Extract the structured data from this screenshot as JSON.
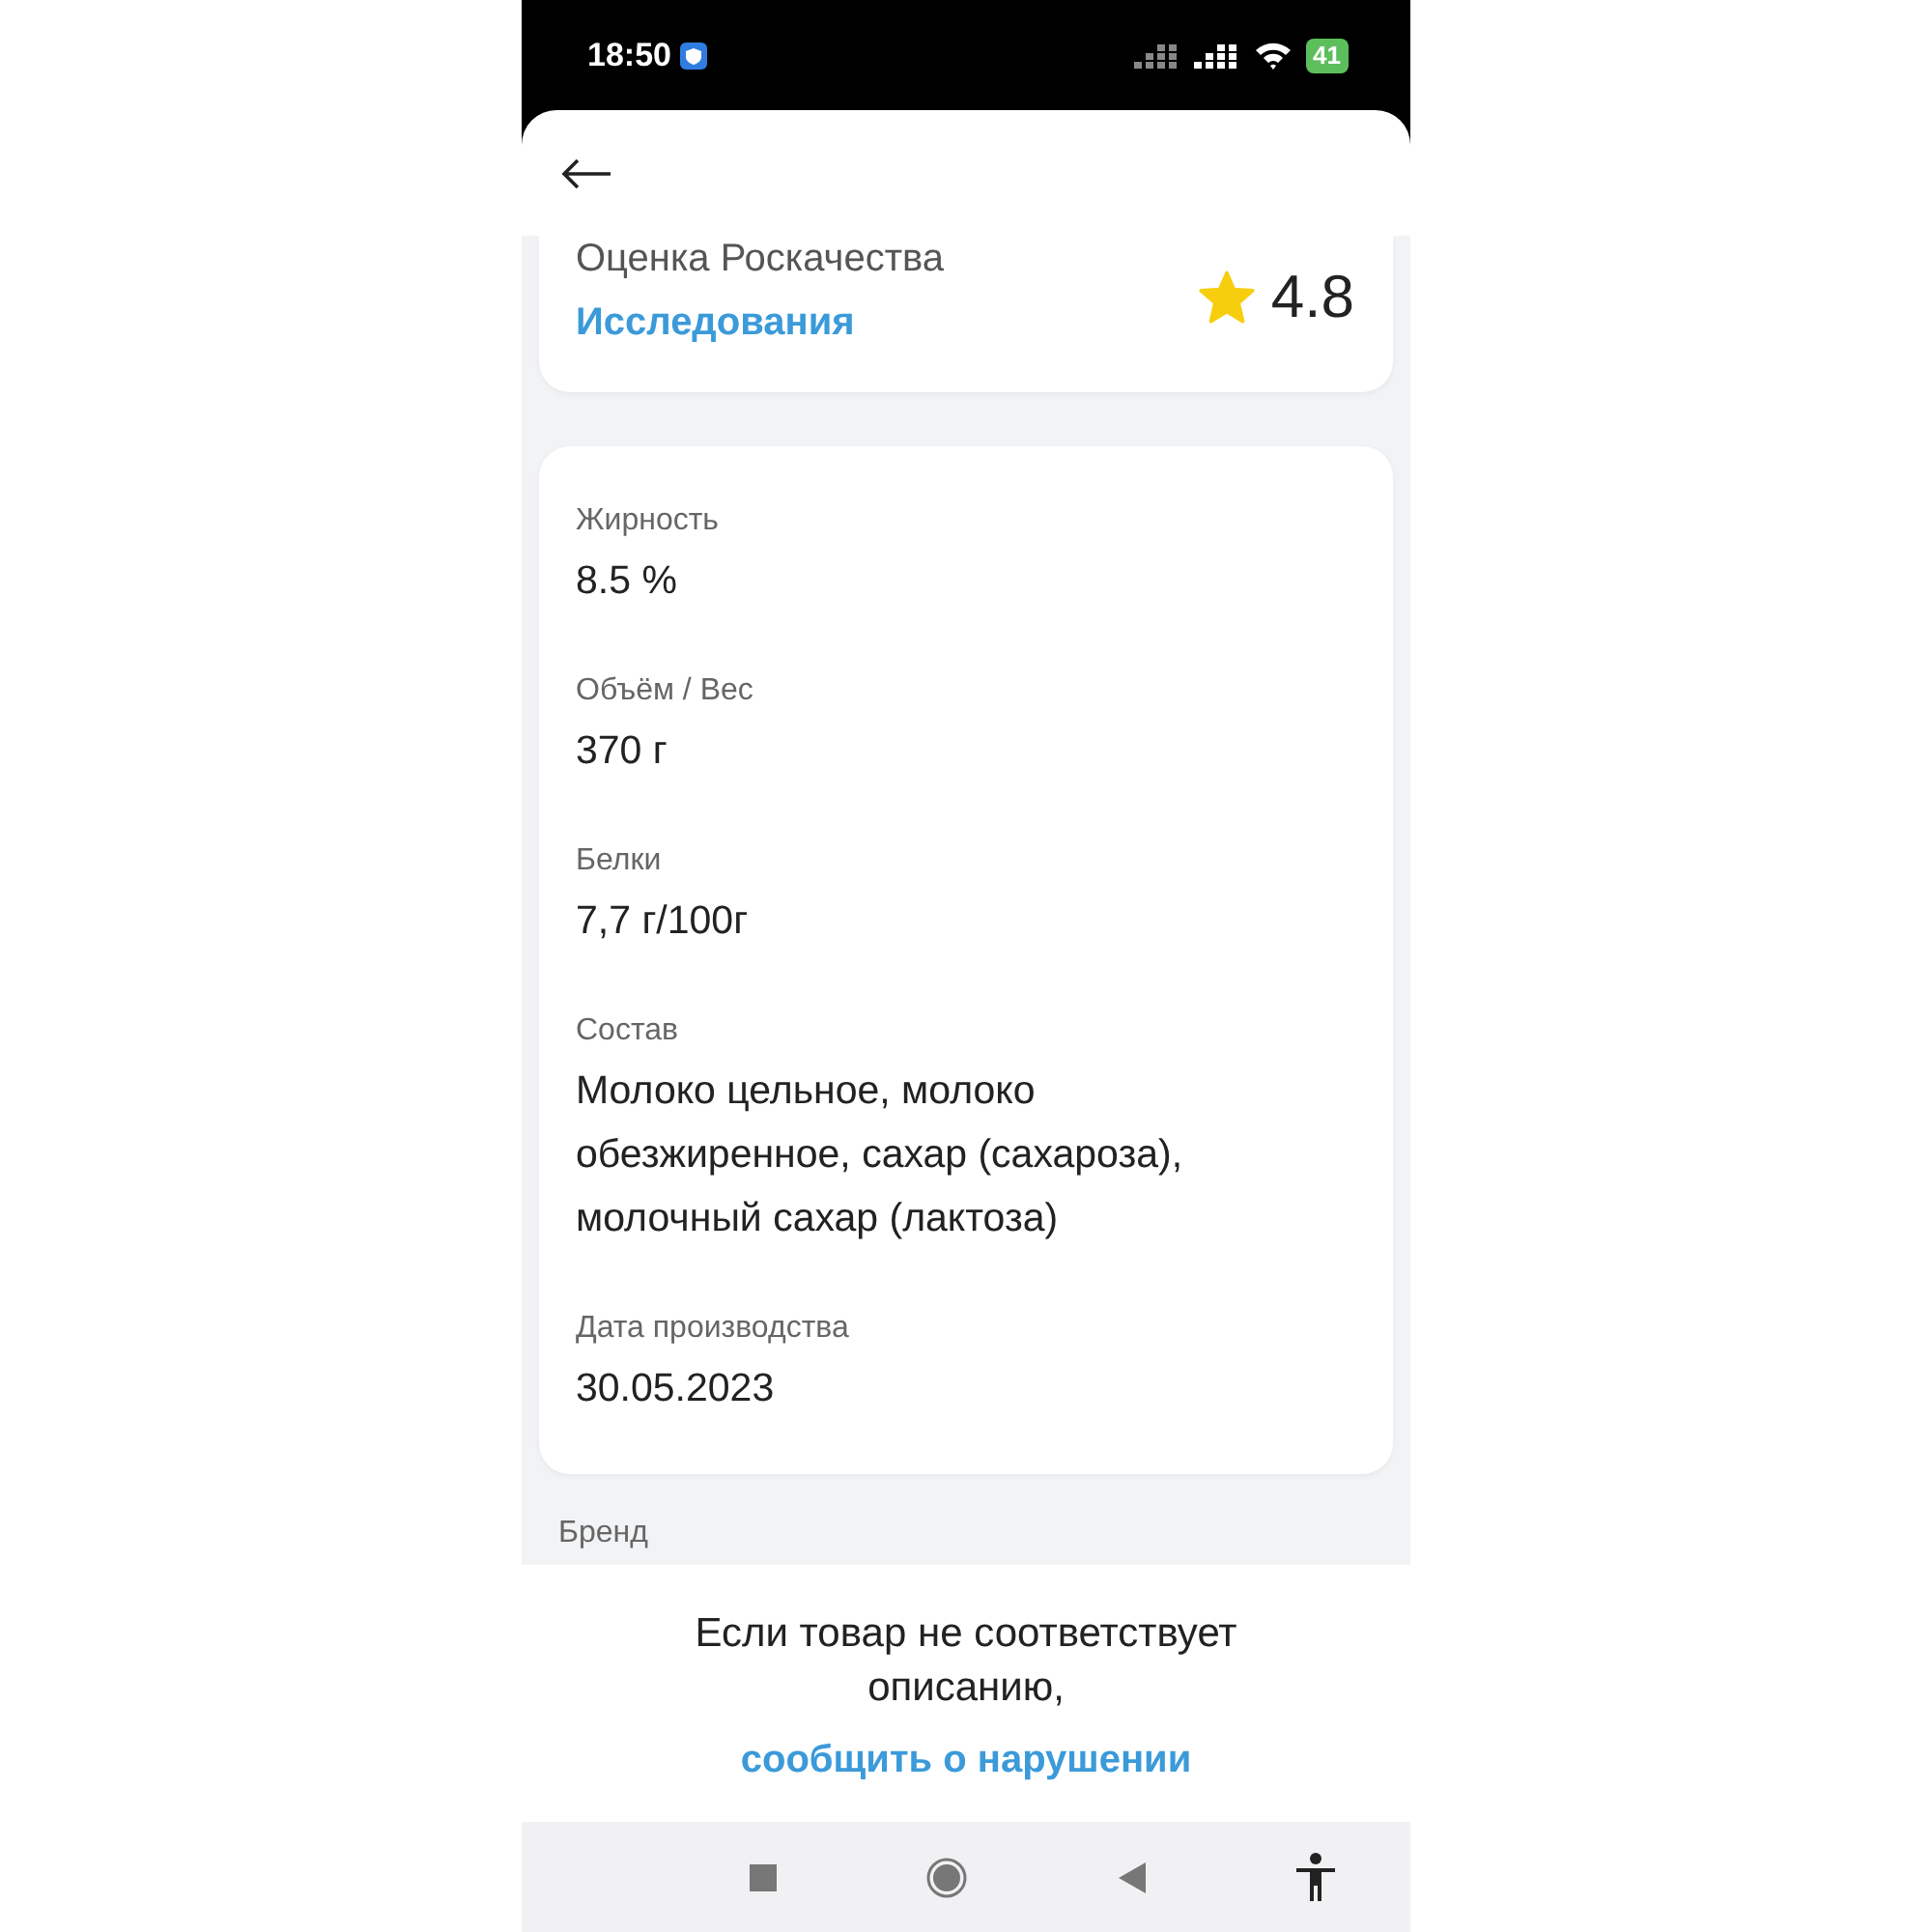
{
  "status_bar": {
    "time": "18:50",
    "battery": "41"
  },
  "rating_card": {
    "title": "Оценка Роскачества",
    "link": "Исследования",
    "rating": "4.8"
  },
  "details": [
    {
      "label": "Жирность",
      "value": "8.5 %"
    },
    {
      "label": "Объём / Вес",
      "value": "370 г"
    },
    {
      "label": "Белки",
      "value": "7,7 г/100г"
    },
    {
      "label": "Состав",
      "value": "Молоко цельное, молоко обезжиренное, сахар (сахароза), молочный сахар (лактоза)"
    },
    {
      "label": "Дата производства",
      "value": "30.05.2023"
    }
  ],
  "next_label": "Бренд",
  "report": {
    "text": "Если товар не соответствует описанию,",
    "link": "сообщить о нарушении"
  }
}
